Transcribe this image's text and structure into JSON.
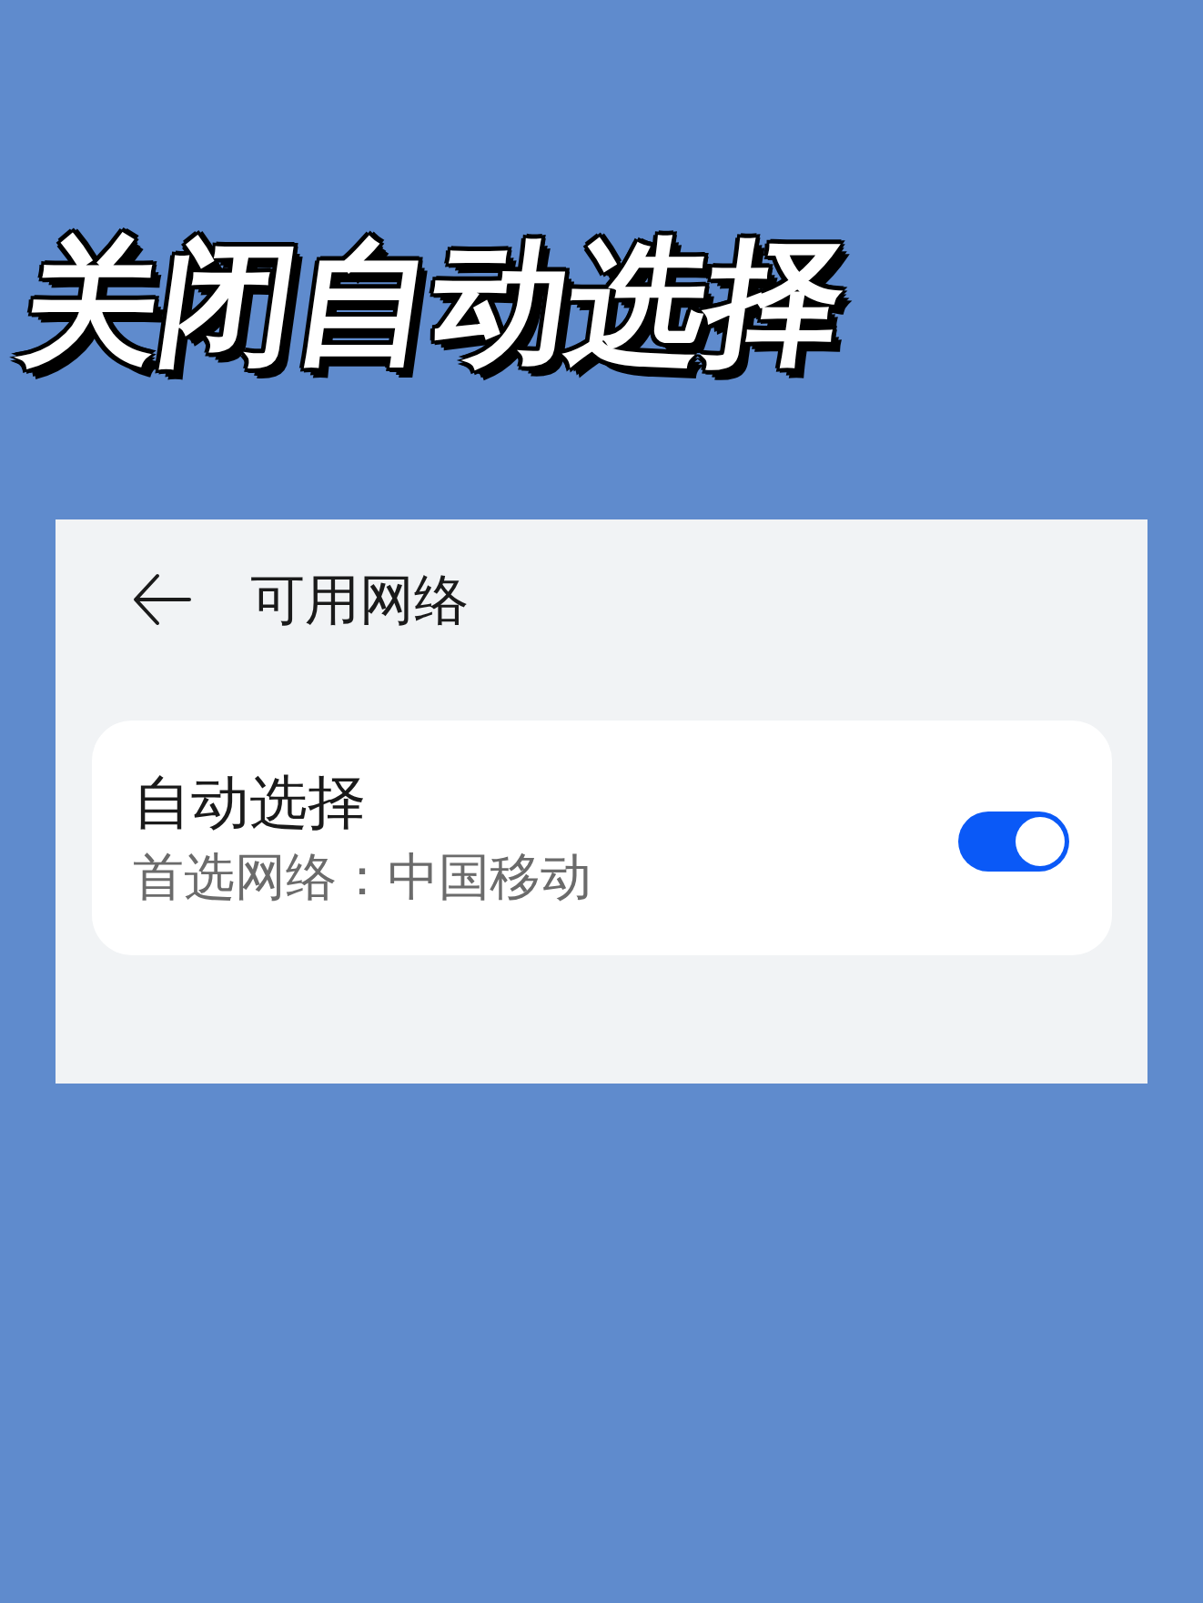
{
  "headline": {
    "text": "关闭自动选择"
  },
  "screen": {
    "header": {
      "title": "可用网络"
    },
    "settings": [
      {
        "kind": "toggle",
        "title": "自动选择",
        "subtitle": "首选网络：中国移动",
        "on": true
      }
    ]
  }
}
